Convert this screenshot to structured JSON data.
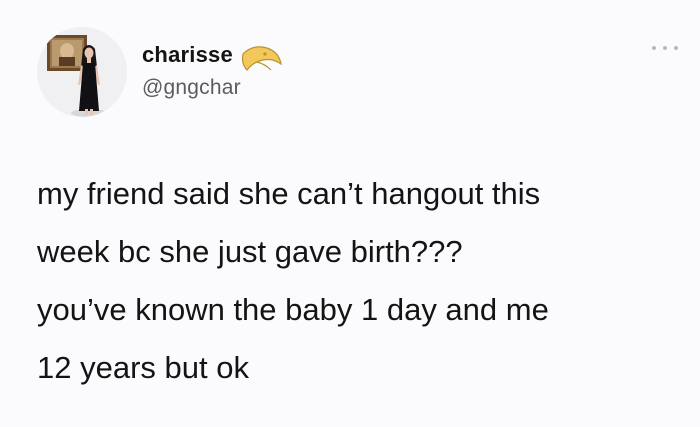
{
  "author": {
    "display_name": "charisse",
    "handle": "@gngchar",
    "avatar": "profile-photo",
    "name_emoji": "crescent-moon-emoji"
  },
  "menu": {
    "icon": "more-options-icon"
  },
  "tweet": {
    "lines": [
      "my friend said she can’t hangout this",
      "week bc she just gave birth???",
      "you’ve known the baby 1 day and me",
      "12 years but ok"
    ]
  },
  "colors": {
    "background": "#fbfbfd",
    "text": "#141414",
    "handle": "#5b5b60",
    "menu_dots": "#b9b9bd",
    "emoji_moon": "#f3c85a"
  }
}
